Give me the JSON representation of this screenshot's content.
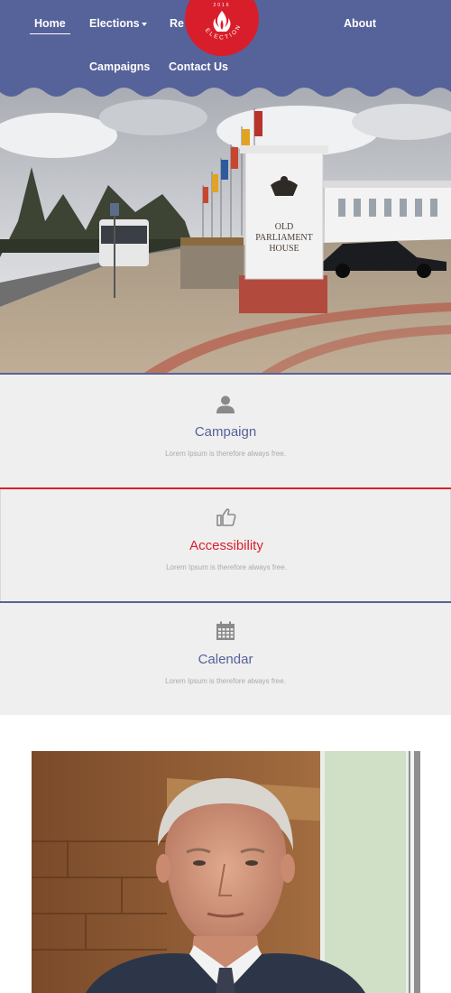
{
  "nav": {
    "items": [
      {
        "label": "Home",
        "active": true
      },
      {
        "label": "Elections",
        "has_dropdown": true
      },
      {
        "label": "Re"
      },
      {
        "label": "About"
      },
      {
        "label": "Campaigns"
      },
      {
        "label": "Contact Us"
      }
    ]
  },
  "logo": {
    "year": "2016",
    "text": "ELECTION",
    "icon": "flame-icon"
  },
  "hero": {
    "sign_line1": "OLD",
    "sign_line2": "PARLIAMENT",
    "sign_line3": "HOUSE"
  },
  "features": [
    {
      "icon": "user-icon",
      "title": "Campaign",
      "text": "Lorem Ipsum is therefore always free.",
      "title_color": "#56629a"
    },
    {
      "icon": "thumbs-up-icon",
      "title": "Accessibility",
      "text": "Lorem Ipsum is therefore always free.",
      "title_color": "#d91e2b"
    },
    {
      "icon": "calendar-icon",
      "title": "Calendar",
      "text": "Lorem Ipsum is therefore always free.",
      "title_color": "#56629a"
    }
  ],
  "colors": {
    "brand_blue": "#56629a",
    "brand_red": "#d91e2b",
    "panel_gray": "#efefef"
  }
}
